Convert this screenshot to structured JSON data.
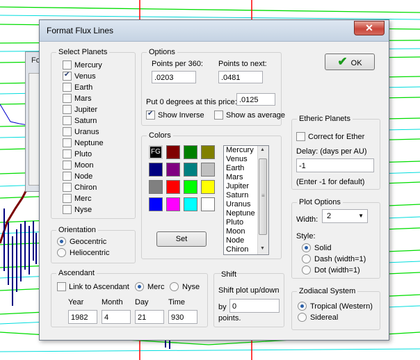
{
  "background_window": {
    "title": "Fo"
  },
  "dialog": {
    "title": "Format Flux Lines",
    "ok_label": "OK"
  },
  "select_planets": {
    "label": "Select Planets",
    "items": [
      {
        "label": "Mercury",
        "checked": false
      },
      {
        "label": "Venus",
        "checked": true
      },
      {
        "label": "Earth",
        "checked": false
      },
      {
        "label": "Mars",
        "checked": false
      },
      {
        "label": "Jupiter",
        "checked": false
      },
      {
        "label": "Saturn",
        "checked": false
      },
      {
        "label": "Uranus",
        "checked": false
      },
      {
        "label": "Neptune",
        "checked": false
      },
      {
        "label": "Pluto",
        "checked": false
      },
      {
        "label": "Moon",
        "checked": false
      },
      {
        "label": "Node",
        "checked": false
      },
      {
        "label": "Chiron",
        "checked": false
      },
      {
        "label": "Merc",
        "checked": false
      },
      {
        "label": "Nyse",
        "checked": false
      }
    ]
  },
  "options": {
    "label": "Options",
    "points_per_360_label": "Points per 360:",
    "points_per_360_value": ".0203",
    "points_to_next_label": "Points to next:",
    "points_to_next_value": ".0481",
    "zero_price_label": "Put 0 degrees at this price:",
    "zero_price_value": ".0125",
    "show_inverse_label": "Show Inverse",
    "show_inverse_checked": true,
    "show_average_label": "Show as average",
    "show_average_checked": false
  },
  "colors": {
    "label": "Colors",
    "fg_label": "FG",
    "swatches": [
      "#000000",
      "#800000",
      "#008000",
      "#808000",
      "#000080",
      "#800080",
      "#008080",
      "#c0c0c0",
      "#808080",
      "#ff0000",
      "#00ff00",
      "#ffff00",
      "#0000ff",
      "#ff00ff",
      "#00ffff",
      "#ffffff"
    ],
    "list": [
      "Mercury",
      "Venus",
      "Earth",
      "Mars",
      "Jupiter",
      "Saturn",
      "Uranus",
      "Neptune",
      "Pluto",
      "Moon",
      "Node",
      "Chiron"
    ],
    "set_label": "Set"
  },
  "etheric": {
    "label": "Etheric Planets",
    "correct_label": "Correct for Ether",
    "correct_checked": false,
    "delay_label": "Delay: (days per AU)",
    "delay_value": "-1",
    "hint": "(Enter -1 for default)"
  },
  "orientation": {
    "label": "Orientation",
    "options": [
      {
        "label": "Geocentric",
        "selected": true
      },
      {
        "label": "Heliocentric",
        "selected": false
      }
    ]
  },
  "plot_options": {
    "label": "Plot Options",
    "width_label": "Width:",
    "width_value": "2",
    "style_label": "Style:",
    "styles": [
      {
        "label": "Solid",
        "selected": true
      },
      {
        "label": "Dash (width=1)",
        "selected": false
      },
      {
        "label": "Dot (width=1)",
        "selected": false
      }
    ]
  },
  "ascendant": {
    "label": "Ascendant",
    "link_label": "Link to Ascendant",
    "link_checked": false,
    "merc_label": "Merc",
    "merc_selected": true,
    "nyse_label": "Nyse",
    "nyse_selected": false,
    "year_label": "Year",
    "year_value": "1982",
    "month_label": "Month",
    "month_value": "4",
    "day_label": "Day",
    "day_value": "21",
    "time_label": "Time",
    "time_value": "930"
  },
  "shift": {
    "label": "Shift",
    "desc": "Shift plot up/down",
    "by_label": "by",
    "value": "0",
    "points_label": "points."
  },
  "zodiacal": {
    "label": "Zodiacal System",
    "options": [
      {
        "label": "Tropical (Western)",
        "selected": true
      },
      {
        "label": "Sidereal",
        "selected": false
      }
    ]
  }
}
